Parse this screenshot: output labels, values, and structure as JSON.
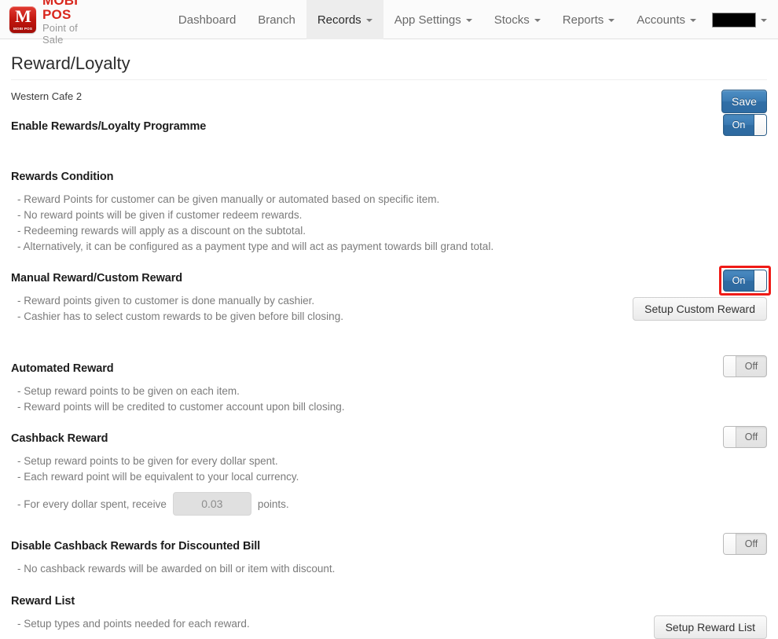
{
  "navbar": {
    "brand": {
      "title": "MOBI POS",
      "subtitle": "Point of Sale",
      "mark_letter": "M",
      "mark_sub": "MOBI POS"
    },
    "items": [
      {
        "label": "Dashboard",
        "has_caret": false,
        "active": false
      },
      {
        "label": "Branch",
        "has_caret": false,
        "active": false
      },
      {
        "label": "Records",
        "has_caret": true,
        "active": true
      },
      {
        "label": "App Settings",
        "has_caret": true,
        "active": false
      },
      {
        "label": "Stocks",
        "has_caret": true,
        "active": false
      },
      {
        "label": "Reports",
        "has_caret": true,
        "active": false
      },
      {
        "label": "Accounts",
        "has_caret": true,
        "active": false
      }
    ],
    "account_menu": {
      "label": "",
      "redacted": true,
      "has_caret": true
    }
  },
  "page": {
    "title": "Reward/Loyalty",
    "save_label": "Save",
    "branch_name": "Western Cafe 2"
  },
  "toggles": {
    "on_label": "On",
    "off_label": "Off"
  },
  "sections": {
    "enable": {
      "title": "Enable Rewards/Loyalty Programme",
      "toggle_state": "On"
    },
    "rewards_condition": {
      "title": "Rewards Condition",
      "bullets": [
        "- Reward Points for customer can be given manually or automated based on specific item.",
        "- No reward points will be given if customer redeem rewards.",
        "- Redeeming rewards will apply as a discount on the subtotal.",
        "- Alternatively, it can be configured as a payment type and will act as payment towards bill grand total."
      ]
    },
    "manual_reward": {
      "title": "Manual Reward/Custom Reward",
      "bullets": [
        "- Reward points given to customer is done manually by cashier.",
        "- Cashier has to select custom rewards to be given before bill closing."
      ],
      "toggle_state": "On",
      "highlighted": true,
      "button_label": "Setup Custom Reward"
    },
    "automated_reward": {
      "title": "Automated Reward",
      "bullets": [
        "- Setup reward points to be given on each item.",
        "- Reward points will be credited to customer account upon bill closing."
      ],
      "toggle_state": "Off"
    },
    "cashback_reward": {
      "title": "Cashback Reward",
      "bullets": [
        "- Setup reward points to be given for every dollar spent.",
        "- Each reward point will be equivalent to your local currency."
      ],
      "rate_prefix": "- For every dollar spent, receive",
      "rate_value": "0.03",
      "rate_suffix": "points.",
      "toggle_state": "Off"
    },
    "disable_cashback_discounted": {
      "title": "Disable Cashback Rewards for Discounted Bill",
      "bullets": [
        "- No cashback rewards will be awarded on bill or item with discount."
      ],
      "toggle_state": "Off"
    },
    "reward_list": {
      "title": "Reward List",
      "bullets": [
        "- Setup types and points needed for each reward."
      ],
      "button_label": "Setup Reward List"
    }
  },
  "colors": {
    "brand_red": "#d9261c",
    "accent_blue": "#2f6ca3",
    "highlight_red": "#ef1b17"
  }
}
